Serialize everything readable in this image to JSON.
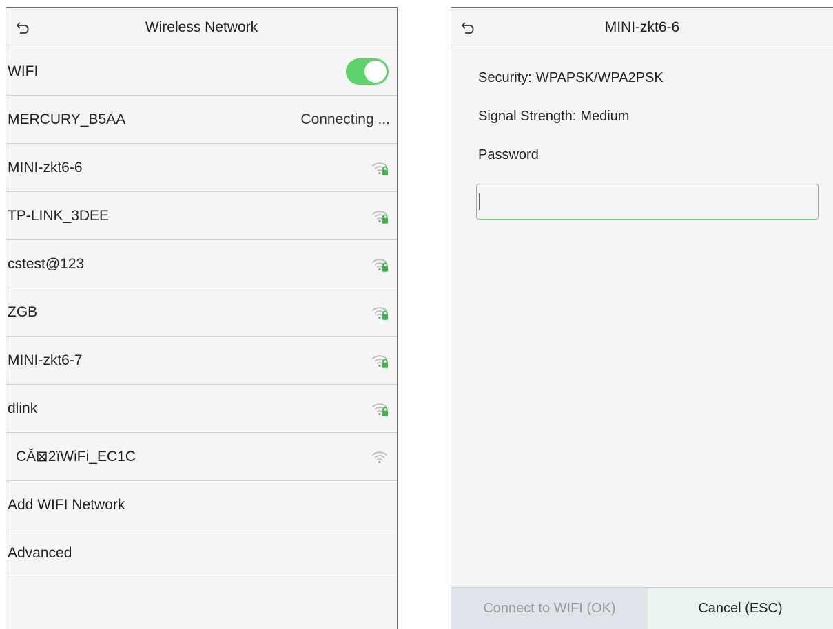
{
  "wireless": {
    "title": "Wireless Network",
    "wifi_label": "WIFI",
    "wifi_enabled": true,
    "colors": {
      "toggle_on": "#5ed36b",
      "lock": "#44b24c"
    },
    "networks": [
      {
        "ssid": "MERCURY_B5AA",
        "status": "Connecting ...",
        "locked": false
      },
      {
        "ssid": "MINI-zkt6-6",
        "status": "",
        "locked": true,
        "icon": "wifi-lock-icon"
      },
      {
        "ssid": "TP-LINK_3DEE",
        "status": "",
        "locked": true,
        "icon": "wifi-lock-icon"
      },
      {
        "ssid": "cstest@123",
        "status": "",
        "locked": true,
        "icon": "wifi-lock-icon"
      },
      {
        "ssid": "ZGB",
        "status": "",
        "locked": true,
        "icon": "wifi-lock-icon"
      },
      {
        "ssid": "MINI-zkt6-7",
        "status": "",
        "locked": true,
        "icon": "wifi-lock-icon"
      },
      {
        "ssid": "dlink",
        "status": "",
        "locked": true,
        "icon": "wifi-lock-icon"
      },
      {
        "ssid": "CĂ⊠2ïWiFi_EC1C",
        "status": "",
        "locked": false,
        "icon": "wifi-icon"
      }
    ],
    "add_label": "Add WIFI Network",
    "advanced_label": "Advanced"
  },
  "detail": {
    "title": "MINI-zkt6-6",
    "security_label": "Security:",
    "security_value": "WPAPSK/WPA2PSK",
    "signal_label": "Signal Strength:",
    "signal_value": "Medium",
    "password_label": "Password",
    "password_value": "",
    "connect_label": "Connect to WIFI (OK)",
    "cancel_label": "Cancel (ESC)",
    "colors": {
      "input_border": "#7dc77e"
    }
  }
}
